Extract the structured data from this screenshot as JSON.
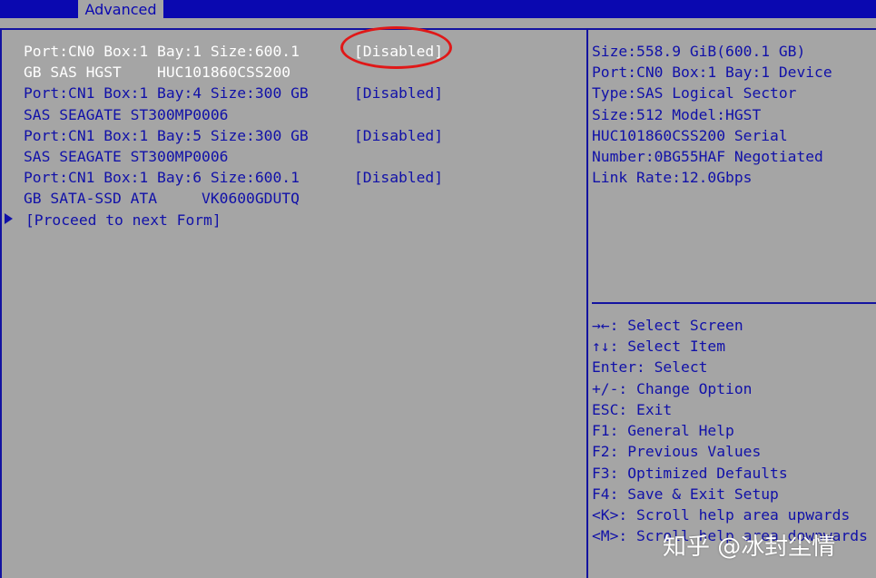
{
  "header": {
    "tab_label": "Advanced"
  },
  "left": {
    "items": [
      {
        "line1": "Port:CN0 Box:1 Bay:1 Size:600.1",
        "line2": "GB SAS HGST    HUC101860CSS200",
        "value": "[Disabled]"
      },
      {
        "line1": "Port:CN1 Box:1 Bay:4 Size:300 GB",
        "line2": "SAS SEAGATE ST300MP0006",
        "value": "[Disabled]"
      },
      {
        "line1": "Port:CN1 Box:1 Bay:5 Size:300 GB",
        "line2": "SAS SEAGATE ST300MP0006",
        "value": "[Disabled]"
      },
      {
        "line1": "Port:CN1 Box:1 Bay:6 Size:600.1",
        "line2": "GB SATA-SSD ATA     VK0600GDUTQ",
        "value": "[Disabled]"
      }
    ],
    "proceed": "[Proceed to next Form]"
  },
  "help": [
    "Size:558.9 GiB(600.1 GB)",
    "Port:CN0 Box:1 Bay:1 Device",
    "Type:SAS Logical Sector",
    "Size:512 Model:HGST",
    "HUC101860CSS200 Serial",
    "Number:0BG55HAF Negotiated",
    "Link Rate:12.0Gbps"
  ],
  "keys": [
    "→←: Select Screen",
    "↑↓: Select Item",
    "Enter: Select",
    "+/-: Change Option",
    "ESC: Exit",
    "F1: General Help",
    "F2: Previous Values",
    "F3: Optimized Defaults",
    "F4: Save & Exit Setup",
    "<K>: Scroll help area upwards",
    "<M>: Scroll help area downwards"
  ],
  "watermark": "知乎 @冰封尘情",
  "colors": {
    "bg": "#a5a5a5",
    "blue": "#0a08b0",
    "white": "#ffffff",
    "highlight": "#e01818"
  }
}
